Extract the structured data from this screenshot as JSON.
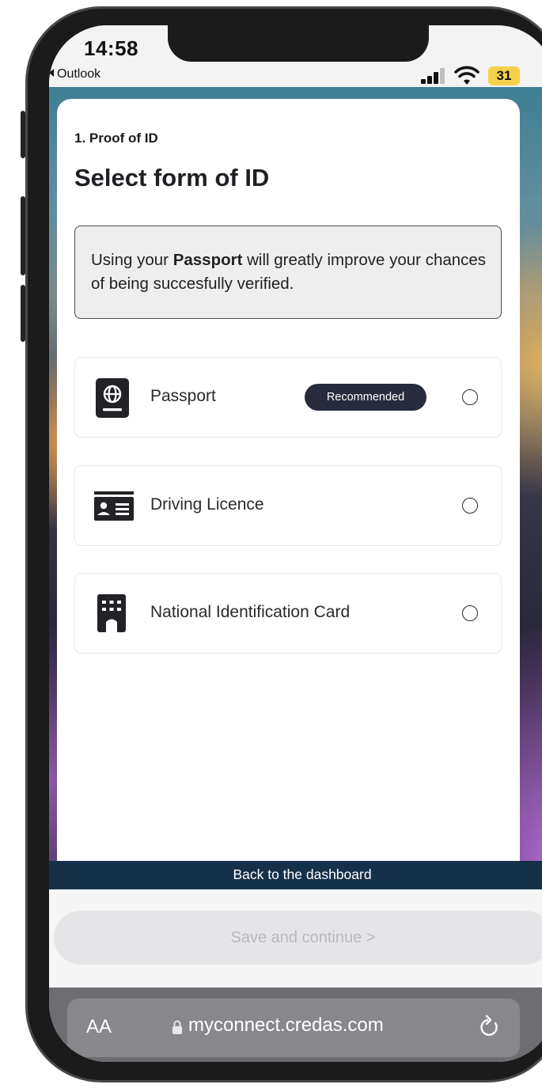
{
  "status_bar": {
    "time": "14:58",
    "back_app": "Outlook",
    "battery": "31"
  },
  "page": {
    "step": "1. Proof of ID",
    "title": "Select form of ID",
    "notice": {
      "prefix": "Using your ",
      "emphasis": "Passport",
      "suffix": " will greatly improve your chances of being succesfully verified."
    }
  },
  "options": [
    {
      "label": "Passport",
      "icon": "passport-icon",
      "badge": "Recommended",
      "selected": false
    },
    {
      "label": "Driving Licence",
      "icon": "id-card-icon",
      "selected": false
    },
    {
      "label": "National Identification Card",
      "icon": "building-icon",
      "selected": false
    }
  ],
  "footer": {
    "dashboard_link": "Back to the dashboard",
    "save_label": "Save and continue",
    "save_chevron": ">"
  },
  "browser": {
    "text_size_label": "AA",
    "url": "myconnect.credas.com"
  },
  "colors": {
    "dashboard_bar": "#153049",
    "badge": "#272b3c",
    "battery": "#f5d14a"
  }
}
